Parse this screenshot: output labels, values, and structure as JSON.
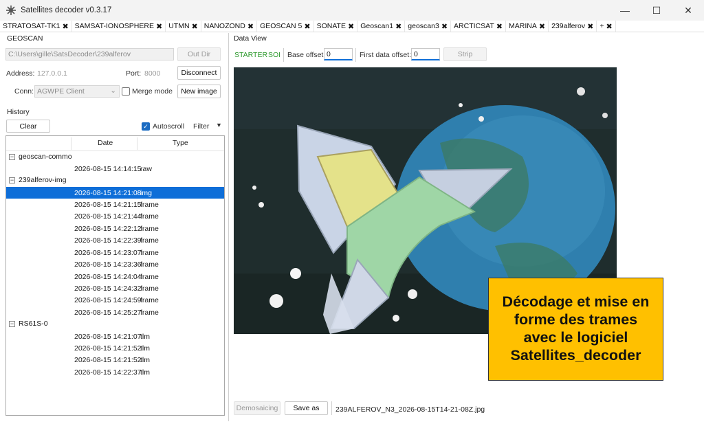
{
  "window": {
    "title": "Satellites decoder v0.3.17",
    "controls": [
      "—",
      "☐",
      "✕"
    ]
  },
  "tabs": [
    "STRATOSAT-TK1",
    "SAMSAT-IONOSPHERE",
    "UTMN",
    "NANOZOND",
    "GEOSCAN 5",
    "SONATE",
    "Geoscan1",
    "geoscan3",
    "ARCTICSAT",
    "MARINA",
    "239alferov",
    "+"
  ],
  "left": {
    "section_title": "GEOSCAN",
    "dir_path": "C:\\Users\\gille\\SatsDecoder\\239alferov",
    "out_dir_label": "Out Dir",
    "address_label": "Address:",
    "address_value": "127.0.0.1",
    "port_label": "Port:",
    "port_value": "8000",
    "disconnect_label": "Disconnect",
    "conn_label": "Conn:",
    "conn_value": "AGWPE Client",
    "merge_label": "Merge mode",
    "new_image_label": "New image",
    "history_title": "History",
    "clear_label": "Clear",
    "autoscroll_label": "Autoscroll",
    "filter_label": "Filter",
    "columns": {
      "date": "Date",
      "type": "Type"
    },
    "groups": [
      {
        "name": "geoscan-commo",
        "rows": [
          {
            "date": "2026-08-15 14:14:15",
            "type": "raw"
          }
        ]
      },
      {
        "name": "239alferov-img",
        "rows": [
          {
            "date": "2026-08-15 14:21:08",
            "type": "img",
            "selected": true
          },
          {
            "date": "2026-08-15 14:21:15",
            "type": "frame"
          },
          {
            "date": "2026-08-15 14:21:44",
            "type": "frame"
          },
          {
            "date": "2026-08-15 14:22:12",
            "type": "frame"
          },
          {
            "date": "2026-08-15 14:22:39",
            "type": "frame"
          },
          {
            "date": "2026-08-15 14:23:07",
            "type": "frame"
          },
          {
            "date": "2026-08-15 14:23:36",
            "type": "frame"
          },
          {
            "date": "2026-08-15 14:24:04",
            "type": "frame"
          },
          {
            "date": "2026-08-15 14:24:32",
            "type": "frame"
          },
          {
            "date": "2026-08-15 14:24:59",
            "type": "frame"
          },
          {
            "date": "2026-08-15 14:25:27",
            "type": "frame"
          }
        ]
      },
      {
        "name": "RS61S-0",
        "rows": [
          {
            "date": "2026-08-15 14:21:07",
            "type": "tlm"
          },
          {
            "date": "2026-08-15 14:21:52",
            "type": "tlm"
          },
          {
            "date": "2026-08-15 14:21:52",
            "type": "tlm"
          },
          {
            "date": "2026-08-15 14:22:37",
            "type": "tlm"
          }
        ]
      }
    ]
  },
  "right": {
    "section_title": "Data View",
    "status_starter": "STARTER",
    "status_soi": "SOI",
    "base_offset_label": "Base offset:",
    "base_offset_value": "0",
    "first_offset_label": "First data offset:",
    "first_offset_value": "0",
    "strip_label": "Strip",
    "demosaicing_label": "Demosaicing",
    "save_as_label": "Save as",
    "file_name": "239ALFEROV_N3_2026-08-15T14-21-08Z.jpg",
    "callout": "Décodage et mise en forme des trames avec le logiciel Satellites_decoder"
  },
  "colors": {
    "accent": "#0e6ed8",
    "callout_bg": "#ffc000",
    "status_green": "#2e9a2e"
  }
}
